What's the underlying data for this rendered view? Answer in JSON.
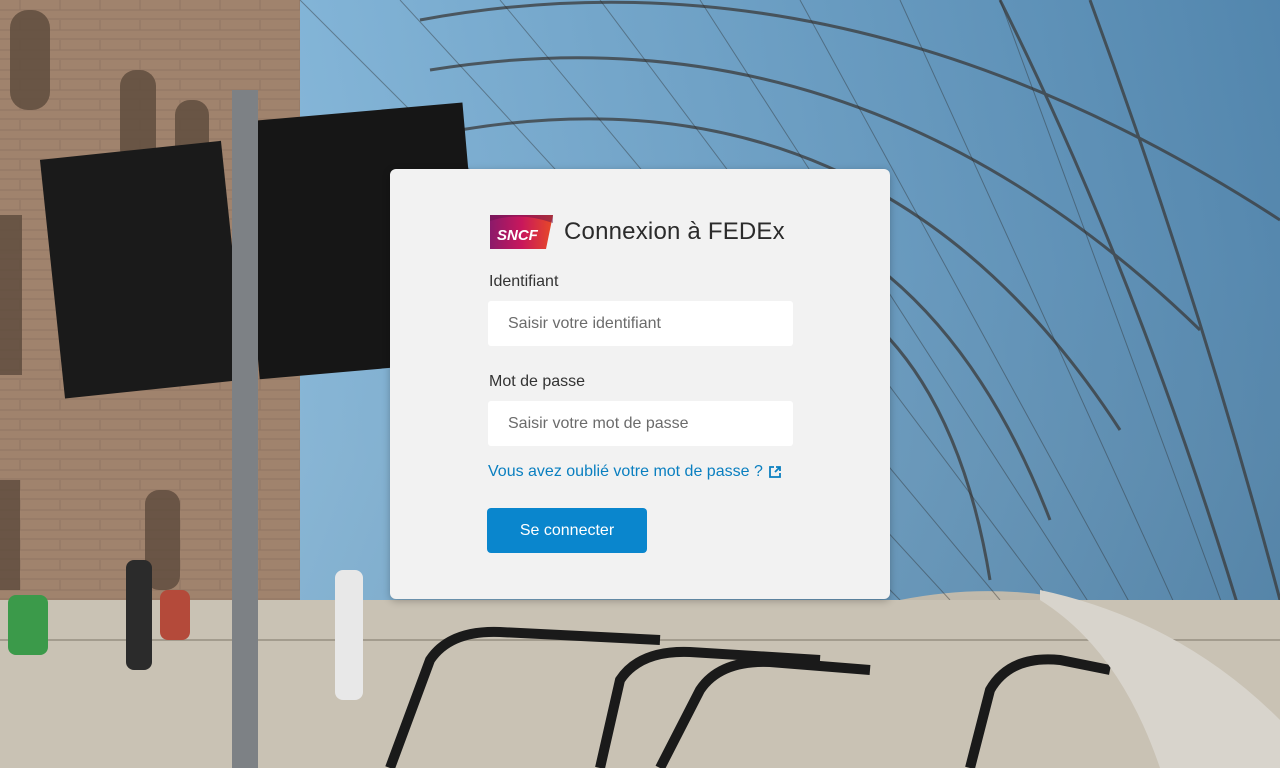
{
  "brand": {
    "logo_text": "SNCF",
    "logo_colors": [
      "#8b1a6a",
      "#c8175c",
      "#e84a26"
    ]
  },
  "login": {
    "title": "Connexion à FEDEx",
    "username_label": "Identifiant",
    "username_placeholder": "Saisir votre identifiant",
    "password_label": "Mot de passe",
    "password_placeholder": "Saisir votre mot de passe",
    "forgot_link": "Vous avez oublié votre mot de passe ?",
    "submit_label": "Se connecter"
  },
  "colors": {
    "accent": "#0a86cd",
    "link": "#0a7fc0",
    "card_bg": "#f2f2f2"
  },
  "icons": {
    "forgot_link_icon": "external-link-icon"
  }
}
